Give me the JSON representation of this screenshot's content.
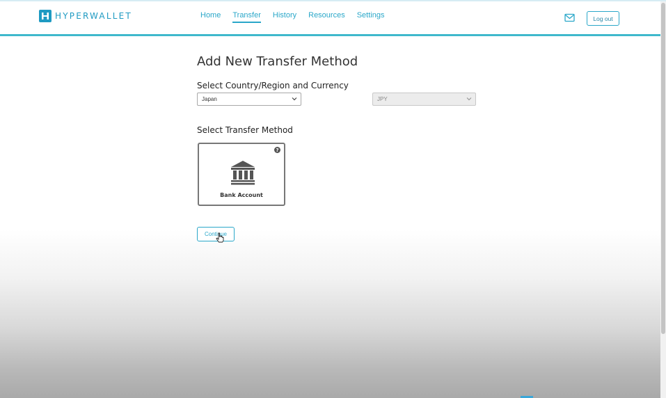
{
  "app": {
    "logo_text": "HYPERWALLET",
    "logo_icon": "hyperwallet-logo-icon"
  },
  "nav": {
    "items": [
      {
        "label": "Home",
        "active": false
      },
      {
        "label": "Transfer",
        "active": true
      },
      {
        "label": "History",
        "active": false
      },
      {
        "label": "Resources",
        "active": false
      },
      {
        "label": "Settings",
        "active": false
      }
    ],
    "mail_icon": "envelope-icon",
    "logout_label": "Log out"
  },
  "page": {
    "title": "Add New Transfer Method"
  },
  "country_section": {
    "label": "Select Country/Region and Currency",
    "country_value": "Japan",
    "currency_value": "JPY"
  },
  "method_section": {
    "label": "Select Transfer Method",
    "card_label": "Bank Account",
    "card_icon": "bank-icon",
    "help_icon": "question-circle-icon",
    "help_glyph": "?"
  },
  "actions": {
    "continue_label": "Continue"
  },
  "colors": {
    "accent": "#2aa7c9",
    "brand": "#1e9ac2",
    "header_border": "#3fb8cc"
  }
}
